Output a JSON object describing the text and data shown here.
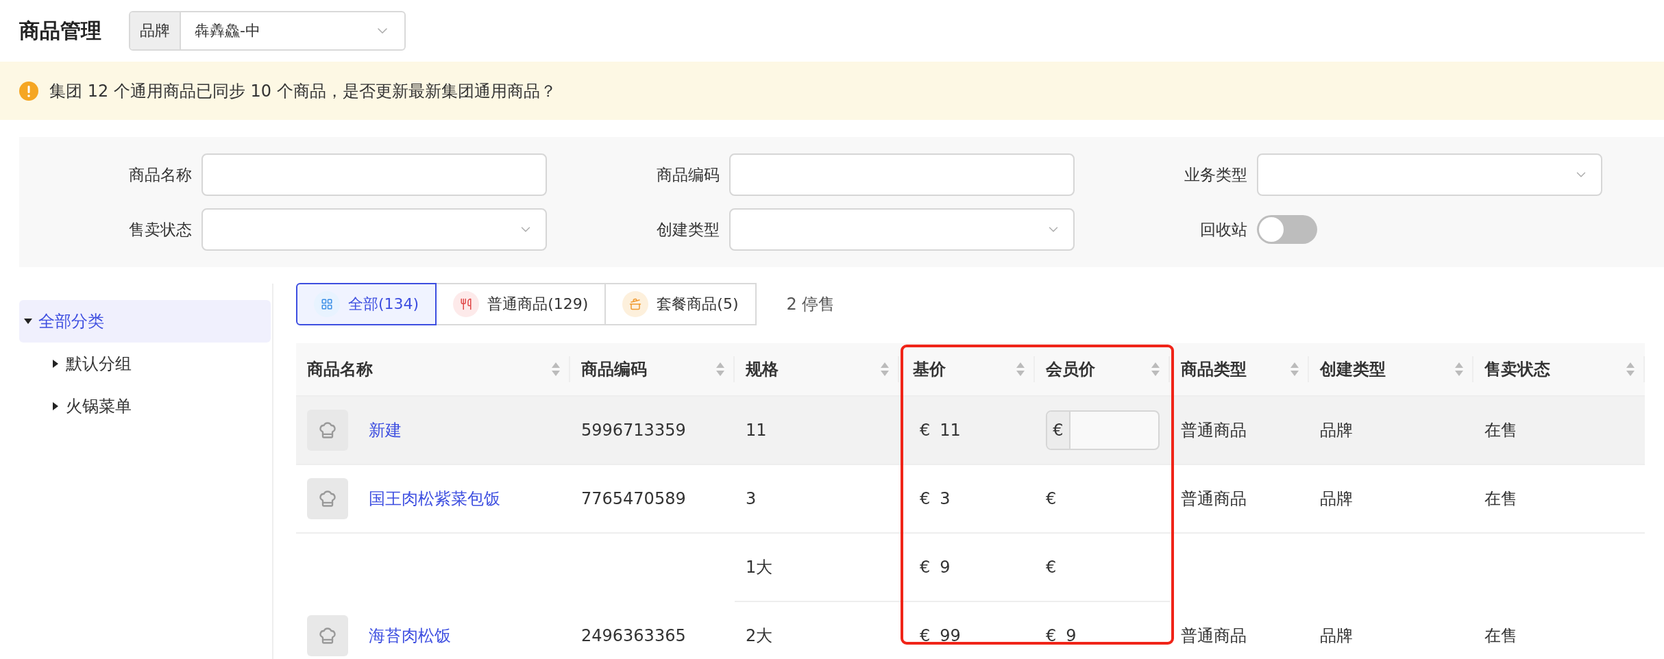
{
  "page_title": "商品管理",
  "brand_select": {
    "label": "品牌",
    "value": "犇羴鱻-中"
  },
  "alert": {
    "text": "集团 12 个通用商品已同步 10 个商品，是否更新最新集团通用商品？"
  },
  "filters": [
    {
      "label": "商品名称",
      "kind": "text"
    },
    {
      "label": "商品编码",
      "kind": "text"
    },
    {
      "label": "业务类型",
      "kind": "select"
    },
    {
      "label": "售卖状态",
      "kind": "select"
    },
    {
      "label": "创建类型",
      "kind": "select"
    },
    {
      "label": "回收站",
      "kind": "switch",
      "on": false
    }
  ],
  "category_tree": [
    {
      "label": "全部分类",
      "selected": true,
      "expanded": true,
      "children": [
        {
          "label": "默认分组",
          "selected": false,
          "expanded": false
        },
        {
          "label": "火锅菜单",
          "selected": false,
          "expanded": false
        }
      ]
    }
  ],
  "type_tabs": [
    {
      "label": "全部(134)",
      "kind": "all",
      "selected": true
    },
    {
      "label": "普通商品(129)",
      "kind": "regular",
      "selected": false
    },
    {
      "label": "套餐商品(5)",
      "kind": "combo",
      "selected": false
    }
  ],
  "stopped_count": "2 停售",
  "table": {
    "columns": [
      {
        "title": "商品名称",
        "highlighted": false
      },
      {
        "title": "商品编码",
        "highlighted": false
      },
      {
        "title": "规格",
        "highlighted": false
      },
      {
        "title": "基价",
        "highlighted": true
      },
      {
        "title": "会员价",
        "highlighted": true
      },
      {
        "title": "商品类型",
        "highlighted": false
      },
      {
        "title": "创建类型",
        "highlighted": false
      },
      {
        "title": "售卖状态",
        "highlighted": false
      }
    ],
    "rows": [
      {
        "name": "新建",
        "code": "5996713359",
        "hovered": true,
        "type": "普通商品",
        "create_type": "品牌",
        "sale_status": "在售",
        "specs": [
          {
            "spec": "11",
            "base_currency": "€",
            "base_amount": "11",
            "member": {
              "kind": "input",
              "currency": "€"
            }
          }
        ]
      },
      {
        "name": "国王肉松紫菜包饭",
        "code": "7765470589",
        "hovered": false,
        "type": "普通商品",
        "create_type": "品牌",
        "sale_status": "在售",
        "specs": [
          {
            "spec": "3",
            "base_currency": "€",
            "base_amount": "3",
            "member": {
              "kind": "text",
              "currency": "€"
            }
          }
        ]
      },
      {
        "name": "海苔肉松饭",
        "code": "2496363365",
        "hovered": false,
        "type": "普通商品",
        "create_type": "品牌",
        "sale_status": "在售",
        "specs": [
          {
            "spec": "1大",
            "base_currency": "€",
            "base_amount": "9",
            "member": {
              "kind": "text",
              "currency": "€"
            }
          },
          {
            "spec": "2大",
            "base_currency": "€",
            "base_amount": "99",
            "member": {
              "kind": "text",
              "currency": "€",
              "amount": "9"
            }
          }
        ]
      }
    ]
  }
}
